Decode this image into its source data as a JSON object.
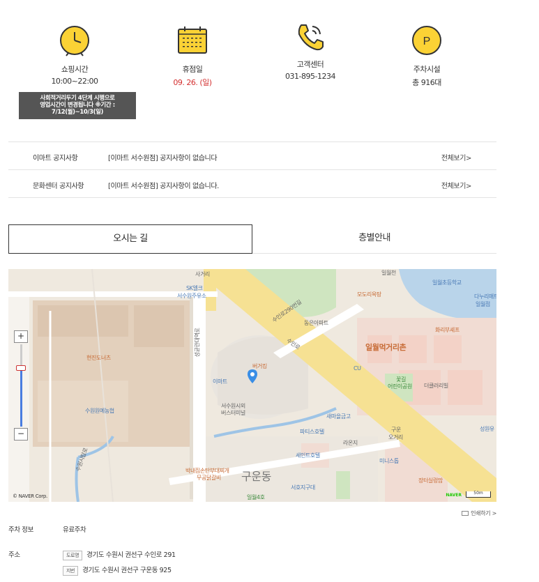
{
  "info": {
    "shopping_hours": {
      "title": "쇼핑시간",
      "value": "10:00~22:00",
      "icon": "clock-icon"
    },
    "closed_day": {
      "title": "휴점일",
      "value": "09. 26. (일)",
      "icon": "calendar-icon"
    },
    "customer_center": {
      "title": "고객센터",
      "value": "031-895-1234",
      "icon": "phone-icon"
    },
    "parking": {
      "title": "주차시설",
      "value": "총 916대",
      "icon": "parking-icon"
    },
    "notice_box": {
      "line1": "사회적거리두기 4단계 시행으로",
      "line2": "영업시간이 변경됩니다 ※기간 :",
      "line3": "7/12(월)~10/3(일)"
    }
  },
  "notices": [
    {
      "label": "이마트 공지사항",
      "text": "[이마트 서수원점] 공지사항이 없습니다",
      "more": "전체보기>"
    },
    {
      "label": "문화센터 공지사항",
      "text": "[이마트 서수원점] 공지사항이 없습니다.",
      "more": "전체보기>"
    }
  ],
  "tabs": {
    "directions": "오시는 길",
    "floor_guide": "층별안내"
  },
  "map": {
    "labels": {
      "sageori": "사거리",
      "sk": "SK엘크",
      "sk2": "서수원주유소",
      "ilwolcheon": "일월천",
      "ilwol_elem": "일월초등학교",
      "modori": "모도리욕탕",
      "danuri": "다누리매트",
      "danuri2": "일월점",
      "suin_road": "수인로290번길",
      "dongeun": "동은아파트",
      "suinro": "수인로",
      "hwari": "화리부셰프",
      "ilwol_street": "일월먹거리촌",
      "cu": "CU",
      "kkotgil": "꽃길",
      "kkotgil2": "어린이공원",
      "deogyeol": "더클러리빌",
      "seongwon": "성원유",
      "hyeonjin": "현진도너츠",
      "burger": "버거킹",
      "emart": "이마트",
      "terminal": "서수원시외",
      "terminal2": "버스터미널",
      "suwon_agri": "수원원예농협",
      "seongyun": "성균관대역로",
      "suwon_ilo": "수원시탑로",
      "semaeul": "새마을금고",
      "patissier": "파티스호텔",
      "raeonji": "라온지",
      "guun": "구운",
      "guun2": "오거리",
      "seinhotel": "세인트호텔",
      "ministop": "미니스톱",
      "tagiyoo": "장터실렁맘",
      "baknae": "박내집손탄부대찌개",
      "baknae2": "무공닭갈비",
      "guundong": "구운동",
      "seohoji": "서호지구대",
      "ilwol4": "일월4호"
    },
    "copyright": "© NAVER Corp.",
    "naver": "NAVER",
    "scale": "50m",
    "zoom_in": "+",
    "zoom_out": "−"
  },
  "print_label": "인쇄하기 >",
  "detail": {
    "parking_label": "주차 정보",
    "parking_value": "유료주차",
    "address_label": "주소",
    "road_tag": "도로명",
    "road_addr": "경기도 수원시 권선구 수인로 291",
    "lot_tag": "지번",
    "lot_addr": "경기도 수원시 권선구 구운동 925"
  },
  "colors": {
    "accent_yellow": "#fbd235",
    "red": "#d32f2f",
    "notice_bg": "#555555"
  }
}
